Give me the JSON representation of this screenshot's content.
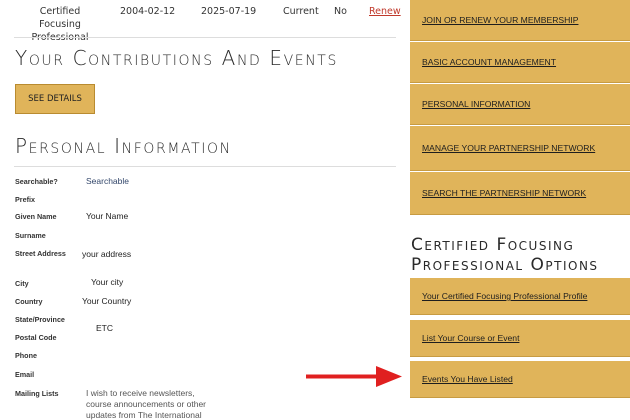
{
  "membership_row": {
    "type": "Certified Focusing Professional",
    "start_date": "2004-02-12",
    "end_date": "2025-07-19",
    "status": "Current",
    "auto": "No",
    "action": "Renew"
  },
  "contributions": {
    "title": "Your Contributions And Events",
    "button": "SEE DETAILS"
  },
  "personal": {
    "title": "Personal Information",
    "fields": {
      "searchable_label": "Searchable?",
      "searchable_value": "Searchable",
      "prefix_label": "Prefix",
      "given_name_label": "Given Name",
      "given_name_value": "Your Name",
      "surname_label": "Surname",
      "street_label": "Street Address",
      "street_value": "your address",
      "city_label": "City",
      "city_value": "Your city",
      "country_label": "Country",
      "country_value": "Your Country",
      "state_label": "State/Province",
      "state_value": "ETC",
      "postal_label": "Postal Code",
      "phone_label": "Phone",
      "email_label": "Email",
      "mailing_label": "Mailing Lists",
      "mailing_value_1": "I wish to receive newsletters,",
      "mailing_value_2": "course announcements or other",
      "mailing_value_3": "updates from The International"
    }
  },
  "sidebar": {
    "links": [
      "JOIN OR RENEW YOUR MEMBERSHIP",
      "BASIC ACCOUNT MANAGEMENT",
      "PERSONAL INFORMATION",
      "MANAGE YOUR PARTNERSHIP NETWORK",
      "SEARCH THE PARTNERSHIP NETWORK"
    ],
    "cfp_title_line1": "Certified Focusing",
    "cfp_title_line2": "Professional Options",
    "cfp_links": [
      "Your Certified Focusing Professional Profile",
      "List Your Course or Event",
      "Events You Have Listed"
    ]
  },
  "colors": {
    "gold": "#e0b45a",
    "arrow": "#e02020",
    "renew_link": "#c0392b"
  }
}
